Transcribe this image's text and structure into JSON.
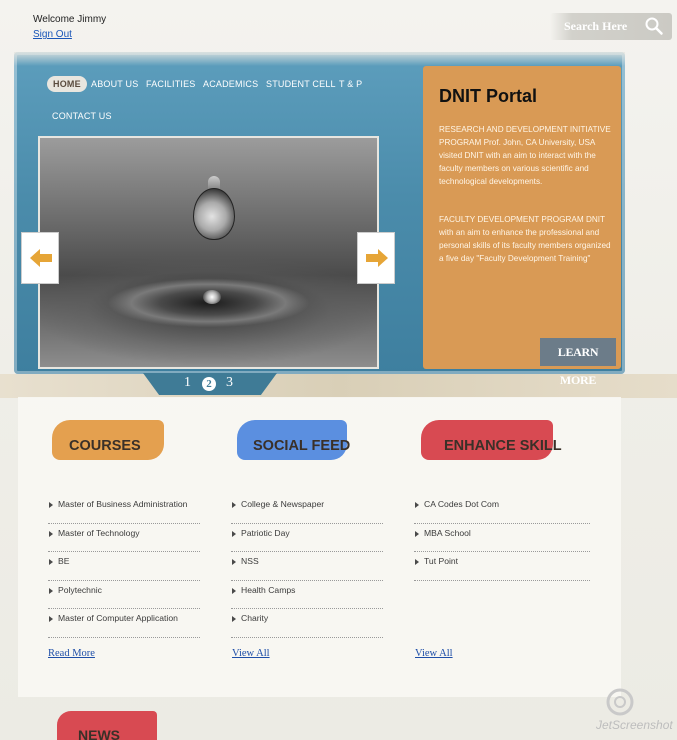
{
  "user": {
    "welcome": "Welcome Jimmy",
    "signout": "Sign Out"
  },
  "search": {
    "placeholder": "Search Here"
  },
  "nav": {
    "items": [
      "HOME",
      "ABOUT US",
      "FACILITIES",
      "ACADEMICS",
      "STUDENT CELL",
      "T & P",
      "CONTACT US"
    ]
  },
  "slider": {
    "pages": [
      "1",
      "2",
      "3"
    ],
    "current": "2"
  },
  "portal": {
    "title": "DNIT Portal",
    "para1": "RESEARCH AND DEVELOPMENT INITIATIVE PROGRAM Prof. John, CA University, USA visited DNIT with an aim to interact with the faculty members on various scientific and technological developments.",
    "para2": "FACULTY DEVELOPMENT PROGRAM DNIT with an aim to enhance the professional and personal skills of its faculty members organized a five day \"Faculty Development Training\"",
    "learn_more": "LEARN MORE"
  },
  "courses": {
    "heading": "COURSES",
    "items": [
      "Master of Business Administration",
      "Master of Technology",
      "BE",
      "Polytechnic",
      "Master of Computer Application"
    ],
    "more": "Read More"
  },
  "social": {
    "heading": "SOCIAL FEED",
    "items": [
      "College & Newspaper",
      "Patriotic Day",
      "NSS",
      "Health Camps",
      "Charity"
    ],
    "more": "View All"
  },
  "skill": {
    "heading": "ENHANCE SKILL",
    "items": [
      "CA Codes Dot Com",
      "MBA School",
      "Tut Point"
    ],
    "more": "View All"
  },
  "news": {
    "heading": "NEWS"
  },
  "watermark": "JetScreenshot",
  "colors": {
    "hero": "#4b8cab",
    "portal": "#d99a55",
    "courses": "#e4a04f",
    "social": "#5b8fe0",
    "skill": "#d84a52",
    "link": "#1e4ea8"
  }
}
